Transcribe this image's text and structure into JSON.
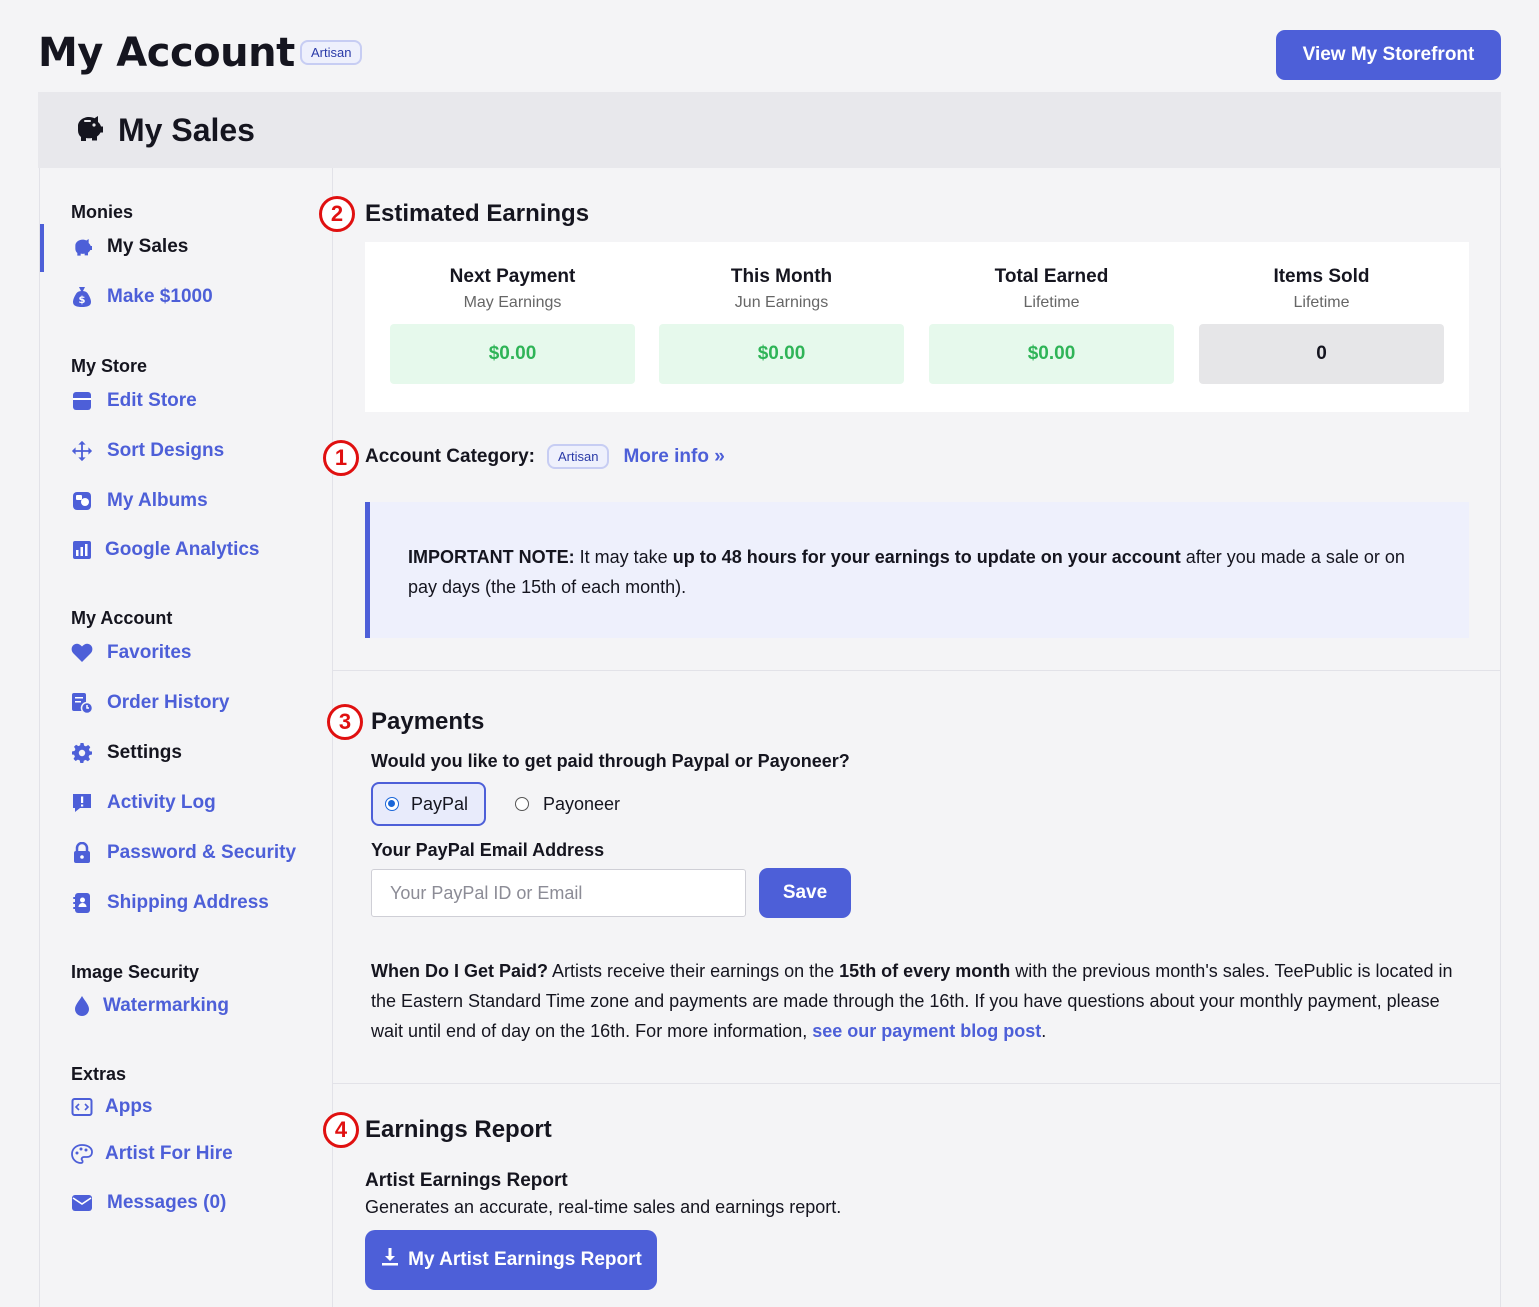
{
  "header": {
    "title": "My Account",
    "badge": "Artisan",
    "storefront_button": "View My Storefront"
  },
  "band": {
    "title": "My Sales",
    "icon": "piggy-bank-icon"
  },
  "sidebar": {
    "groups": [
      "Monies",
      "My Store",
      "My Account",
      "Image Security",
      "Extras"
    ],
    "items": [
      {
        "label": "My Sales",
        "icon": "piggy-bank-icon",
        "active": true
      },
      {
        "label": "Make $1000",
        "icon": "money-bag-icon"
      },
      {
        "label": "Edit Store",
        "icon": "store-icon"
      },
      {
        "label": "Sort Designs",
        "icon": "arrows-move-icon"
      },
      {
        "label": "My Albums",
        "icon": "album-icon"
      },
      {
        "label": "Google Analytics",
        "icon": "bar-chart-icon"
      },
      {
        "label": "Favorites",
        "icon": "heart-icon"
      },
      {
        "label": "Order History",
        "icon": "order-history-icon"
      },
      {
        "label": "Settings",
        "icon": "gear-icon"
      },
      {
        "label": "Activity Log",
        "icon": "alert-icon"
      },
      {
        "label": "Password & Security",
        "icon": "lock-icon"
      },
      {
        "label": "Shipping Address",
        "icon": "address-book-icon"
      },
      {
        "label": "Watermarking",
        "icon": "droplet-icon"
      },
      {
        "label": "Apps",
        "icon": "code-window-icon"
      },
      {
        "label": "Artist For Hire",
        "icon": "palette-icon"
      },
      {
        "label": "Messages (0)",
        "icon": "envelope-icon"
      }
    ]
  },
  "estimated": {
    "heading": "Estimated Earnings",
    "marker": "2",
    "stats": [
      {
        "label": "Next Payment",
        "sub": "May Earnings",
        "value": "$0.00"
      },
      {
        "label": "This Month",
        "sub": "Jun Earnings",
        "value": "$0.00"
      },
      {
        "label": "Total Earned",
        "sub": "Lifetime",
        "value": "$0.00"
      },
      {
        "label": "Items Sold",
        "sub": "Lifetime",
        "value": "0"
      }
    ]
  },
  "category": {
    "marker": "1",
    "label": "Account Category:",
    "badge": "Artisan",
    "more_info": "More info »"
  },
  "note": {
    "lead": "IMPORTANT NOTE:",
    "t1": " It may take ",
    "bold": "up to 48 hours for your earnings to update on your account",
    "t2": " after you made a sale or on pay days (the 15th of each month)."
  },
  "payments": {
    "marker": "3",
    "heading": "Payments",
    "question": "Would you like to get paid through Paypal or Payoneer?",
    "options": [
      "PayPal",
      "Payoneer"
    ],
    "selected": "PayPal",
    "email_label": "Your PayPal Email Address",
    "email_value": "",
    "email_placeholder": "Your PayPal ID or Email",
    "save_button": "Save",
    "paid_lead": "When Do I Get Paid?",
    "paid_t1": " Artists receive their earnings on the ",
    "paid_bold": "15th of every month",
    "paid_t2": " with the previous month's sales. TeePublic is located in the Eastern Standard Time zone and payments are made through the 16th. If you have questions about your monthly payment, please wait until end of day on the 16th. For more information, ",
    "paid_link": "see our payment blog post",
    "paid_end": "."
  },
  "report": {
    "marker": "4",
    "heading": "Earnings Report",
    "title": "Artist Earnings Report",
    "desc": "Generates an accurate, real-time sales and earnings report.",
    "button": "My Artist Earnings Report"
  },
  "colors": {
    "accent": "#4d5fd8",
    "money": "#2fb457",
    "marker": "#e01010"
  }
}
